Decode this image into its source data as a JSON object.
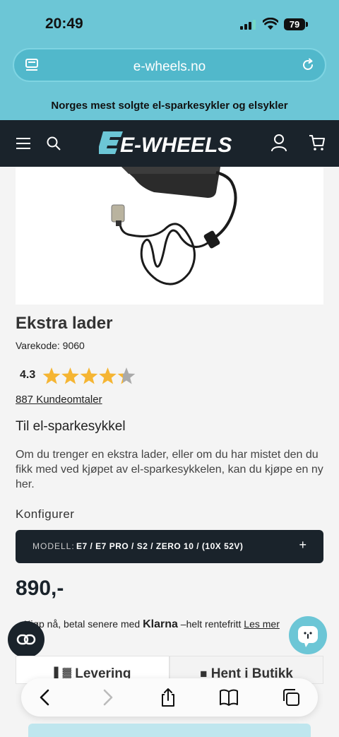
{
  "status_bar": {
    "time": "20:49",
    "battery": "79"
  },
  "browser": {
    "url": "e-wheels.no"
  },
  "promo_banner": {
    "text": "Norges mest solgte el-sparkesykler og elsykler"
  },
  "header": {
    "logo_text": "E-WHEELS"
  },
  "product": {
    "title": "Ekstra lader",
    "sku": "Varekode: 9060",
    "rating": "4.3",
    "rating_fraction": 0.86,
    "reviews": "887 Kundeomtaler",
    "subtitle": "Til el-sparkesykkel",
    "description": "Om du trenger en ekstra lader, eller om du har mistet den du fikk med ved kjøpet av el-sparkesykkelen, kan du kjøpe en ny her.",
    "configure_label": "Konfigurer",
    "config": {
      "key": "MODELL:",
      "value": "E7 / E7 PRO / S2 / ZERO 10 / (10X 52V)",
      "plus": "+"
    },
    "price": "890,-"
  },
  "klarna": {
    "prefix": "Kjøp nå, betal senere med",
    "brand": "Klarna",
    "suffix": "–helt rentefritt",
    "link": "Les mer"
  },
  "tabs": [
    {
      "label": "Levering"
    },
    {
      "label": "Hent i Butikk"
    }
  ],
  "colors": {
    "accent": "#6cc6d6",
    "dark": "#1a232b",
    "star": "#f5b533"
  }
}
